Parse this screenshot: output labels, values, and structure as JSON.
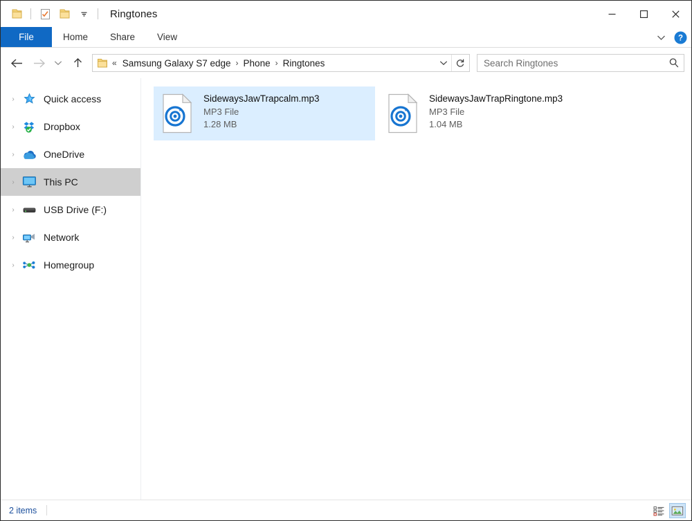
{
  "window": {
    "title": "Ringtones",
    "quick_access": [
      {
        "name": "folder-icon",
        "label": "Folder"
      },
      {
        "name": "properties-icon",
        "label": "Properties"
      },
      {
        "name": "new-folder-icon",
        "label": "New folder"
      },
      {
        "name": "chevron-down-icon",
        "label": "Customize Quick Access Toolbar"
      }
    ],
    "controls": {
      "minimize": "—",
      "maximize": "□",
      "close": "✕"
    }
  },
  "ribbon": {
    "tabs": [
      {
        "label": "File",
        "active": true
      },
      {
        "label": "Home",
        "active": false
      },
      {
        "label": "Share",
        "active": false
      },
      {
        "label": "View",
        "active": false
      }
    ],
    "expand_label": "Expand the Ribbon",
    "help_label": "Help"
  },
  "address": {
    "back_label": "Back",
    "forward_label": "Forward",
    "recent_label": "Recent locations",
    "up_label": "Up",
    "overflow": "«",
    "crumbs": [
      "Samsung Galaxy S7 edge",
      "Phone",
      "Ringtones"
    ],
    "separator": "›",
    "dropdown_label": "Previous locations",
    "refresh_label": "Refresh"
  },
  "search": {
    "placeholder": "Search Ringtones",
    "value": "",
    "icon": "search-icon"
  },
  "sidebar": {
    "items": [
      {
        "label": "Quick access",
        "icon": "star-icon",
        "selected": false,
        "expandable": true
      },
      {
        "label": "Dropbox",
        "icon": "dropbox-icon",
        "selected": false,
        "expandable": true
      },
      {
        "label": "OneDrive",
        "icon": "onedrive-cloud-icon",
        "selected": false,
        "expandable": true
      },
      {
        "label": "This PC",
        "icon": "monitor-icon",
        "selected": true,
        "expandable": true
      },
      {
        "label": "USB Drive (F:)",
        "icon": "drive-icon",
        "selected": false,
        "expandable": true
      },
      {
        "label": "Network",
        "icon": "network-icon",
        "selected": false,
        "expandable": true
      },
      {
        "label": "Homegroup",
        "icon": "homegroup-icon",
        "selected": false,
        "expandable": true
      }
    ],
    "expander_glyph": "›"
  },
  "files": [
    {
      "name": "SidewaysJawTrapcalm.mp3",
      "type": "MP3 File",
      "size": "1.28 MB",
      "icon": "mp3-file-icon",
      "selected": true
    },
    {
      "name": "SidewaysJawTrapRingtone.mp3",
      "type": "MP3 File",
      "size": "1.04 MB",
      "icon": "mp3-file-icon",
      "selected": false
    }
  ],
  "statusbar": {
    "count_text": "2 items",
    "views": [
      {
        "name": "details-view-button",
        "label": "Details view",
        "active": false
      },
      {
        "name": "large-icons-view-button",
        "label": "Large icons view",
        "active": true
      }
    ]
  },
  "colors": {
    "accent": "#1069c4",
    "selection": "#dbeeff",
    "nav_selection": "#cfcfcf",
    "status_text": "#1b4f9c",
    "folder_yellow": "#f6d06a"
  }
}
